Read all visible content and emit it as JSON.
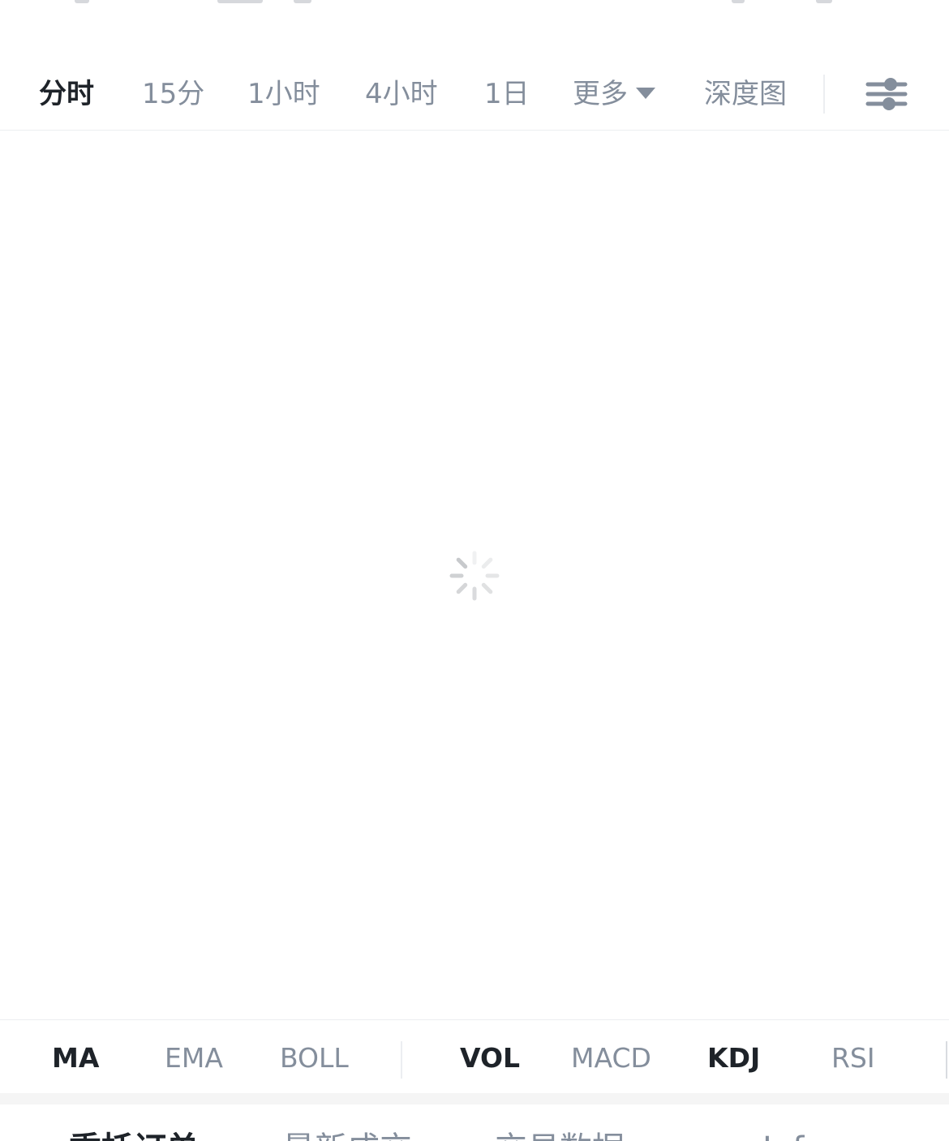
{
  "interval_tabs": {
    "fenshi": "分时",
    "m15": "15分",
    "h1": "1小时",
    "h4": "4小时",
    "d1": "1日",
    "more": "更多",
    "depth": "深度图"
  },
  "active_interval": "分时",
  "chart": {
    "state": "loading"
  },
  "indicators": {
    "main": [
      "MA",
      "EMA",
      "BOLL"
    ],
    "sub": [
      "VOL",
      "MACD",
      "KDJ",
      "RSI"
    ],
    "active": [
      "MA",
      "VOL",
      "KDJ"
    ]
  },
  "bottom_tabs": {
    "tab1": "委托订单",
    "tab2": "最新成交",
    "tab3": "交易数据",
    "tab4": "Info"
  },
  "colors": {
    "active_text": "#1e2329",
    "inactive_text": "#848e9c",
    "divider": "#eceef1",
    "spinner": "#c7c9cc"
  },
  "icons": {
    "more_caret": "caret-down-icon",
    "settings": "sliders-icon",
    "loader": "spinner-icon"
  }
}
